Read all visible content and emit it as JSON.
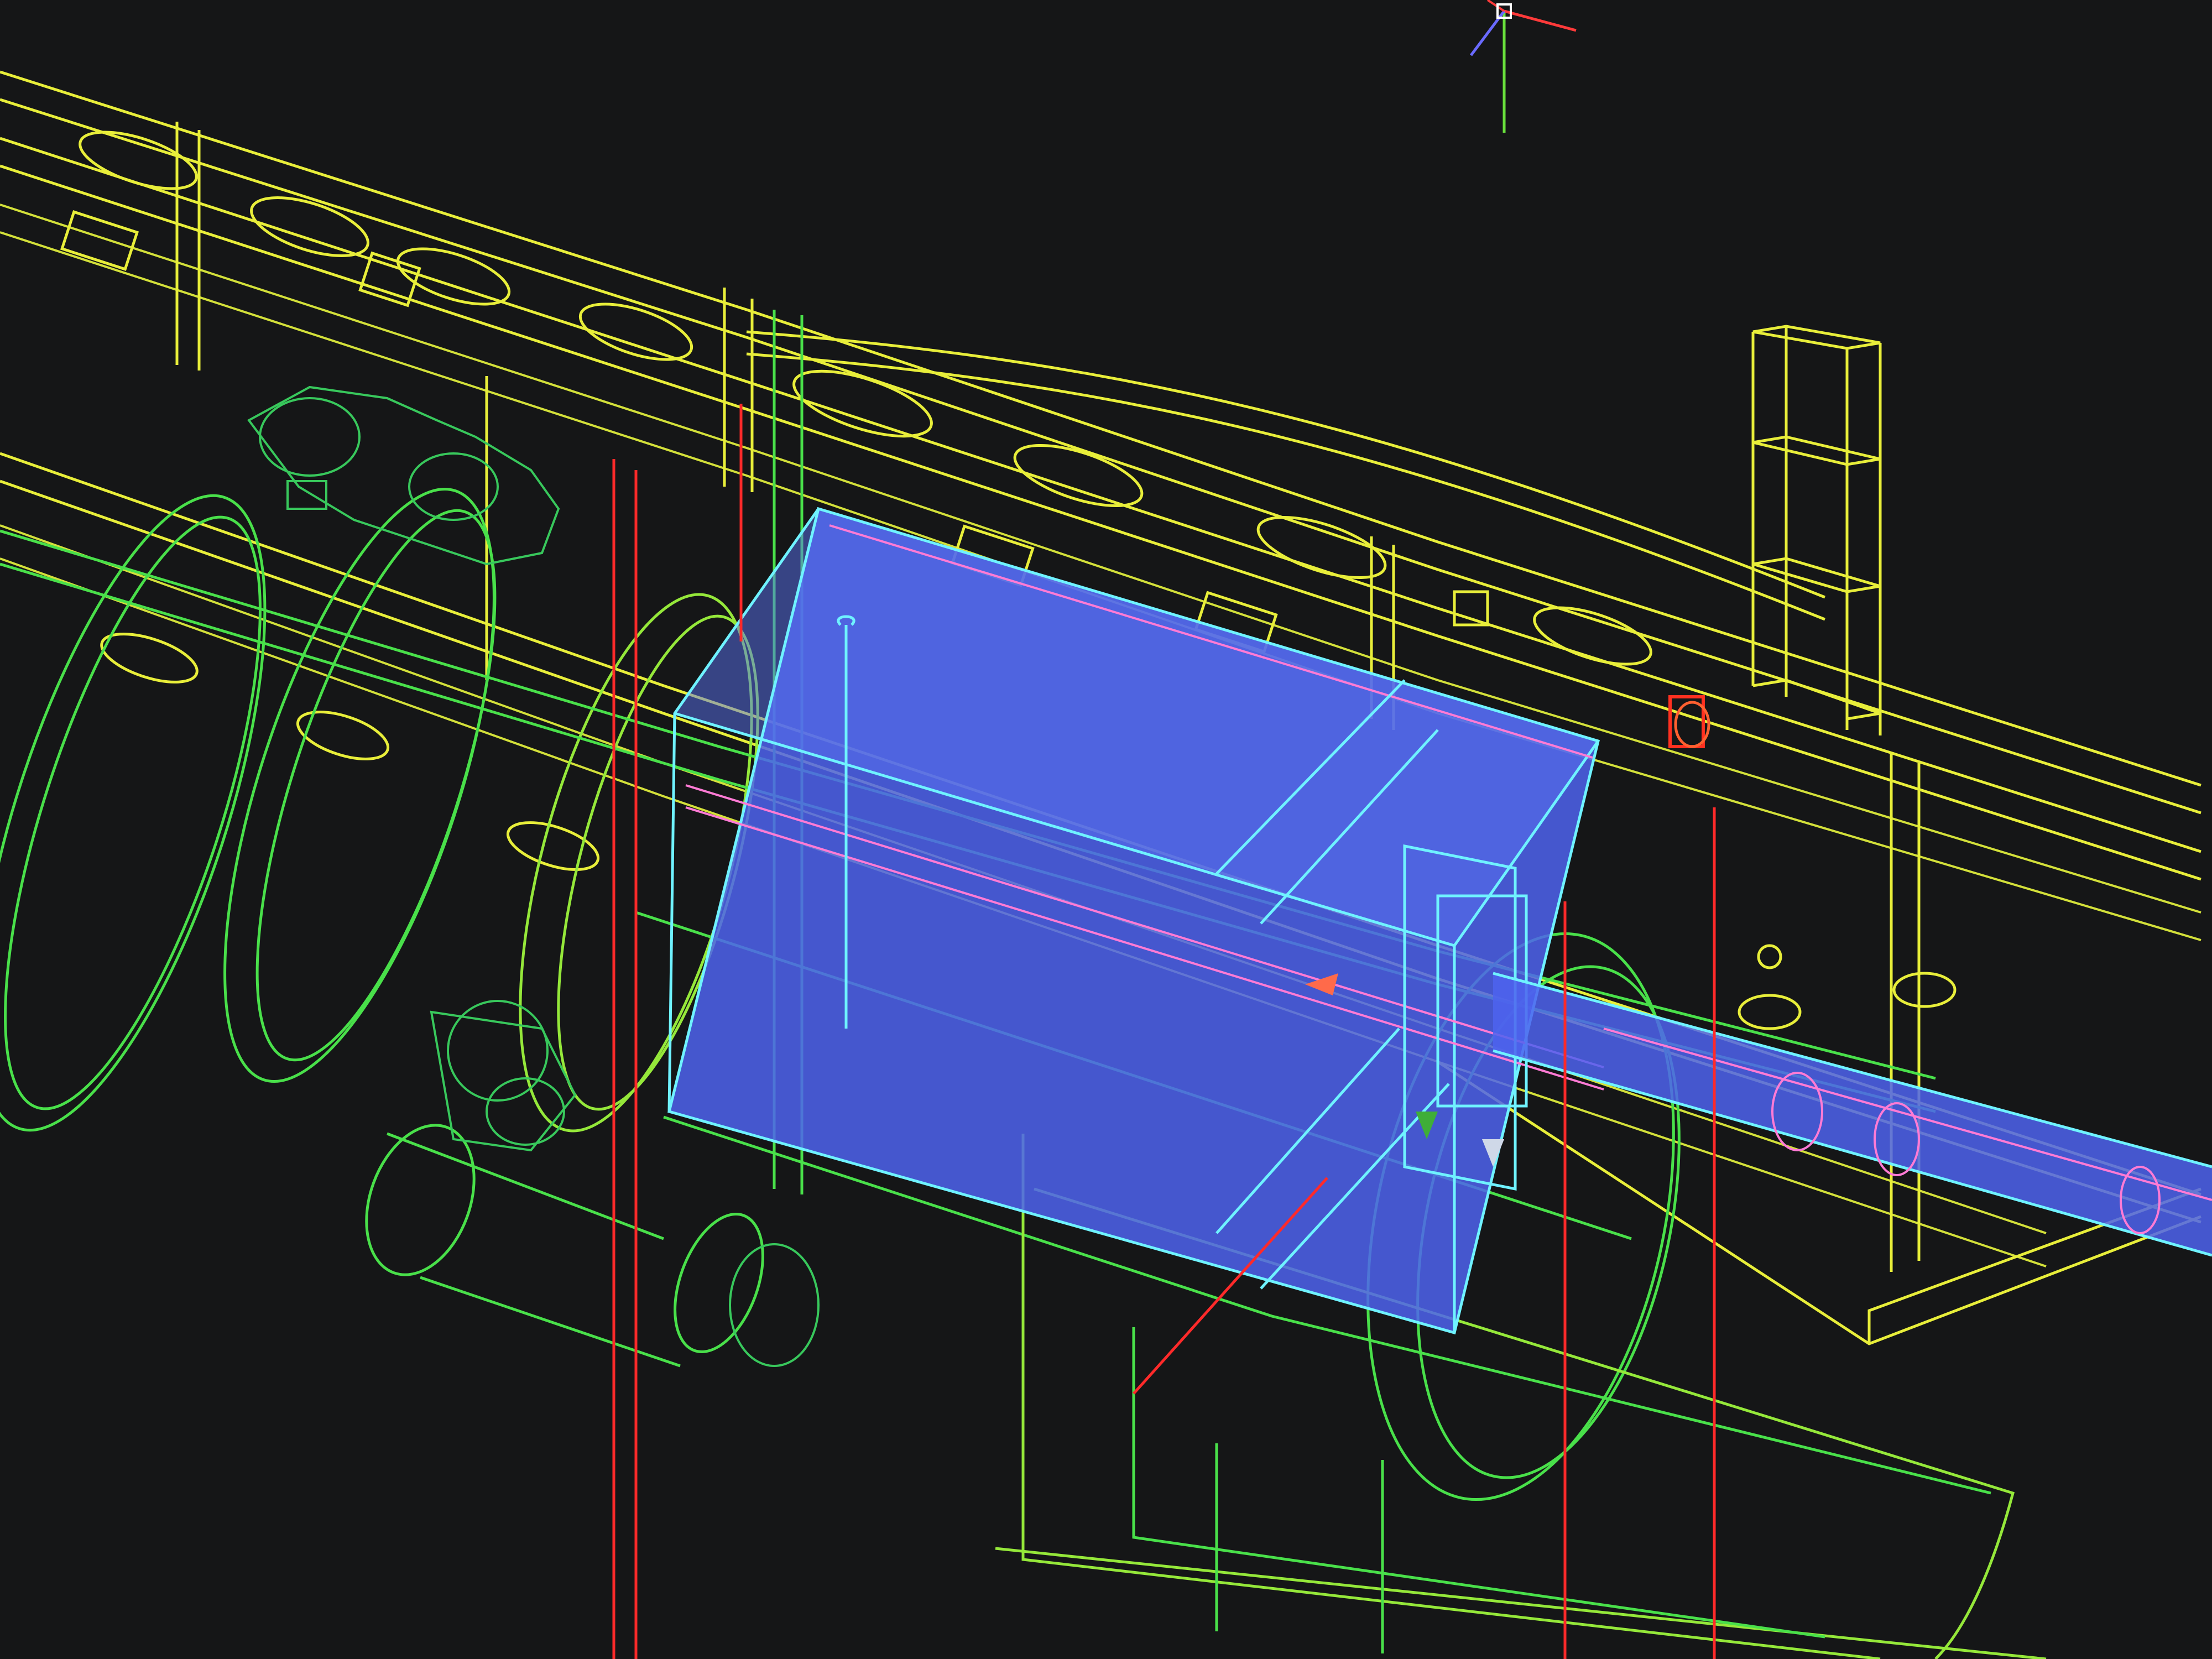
{
  "viewport": {
    "background": "#151617",
    "layers": {
      "frame_color": "#e8ee3a",
      "parts_color": "#49e04a",
      "selected_fill": "#4d63ee",
      "selected_edge": "#6ff2ff",
      "section_line_color": "#ff2a2a",
      "highlight_edge": "#ff7bd5"
    }
  },
  "ucs_icon": {
    "x_axis_color": "#ff3a3a",
    "y_axis_color": "#69e03c",
    "z_axis_color": "#6a6aff"
  },
  "grips": {
    "arrow_color": "#ff6a4a",
    "marker_color": "#ff3020"
  }
}
